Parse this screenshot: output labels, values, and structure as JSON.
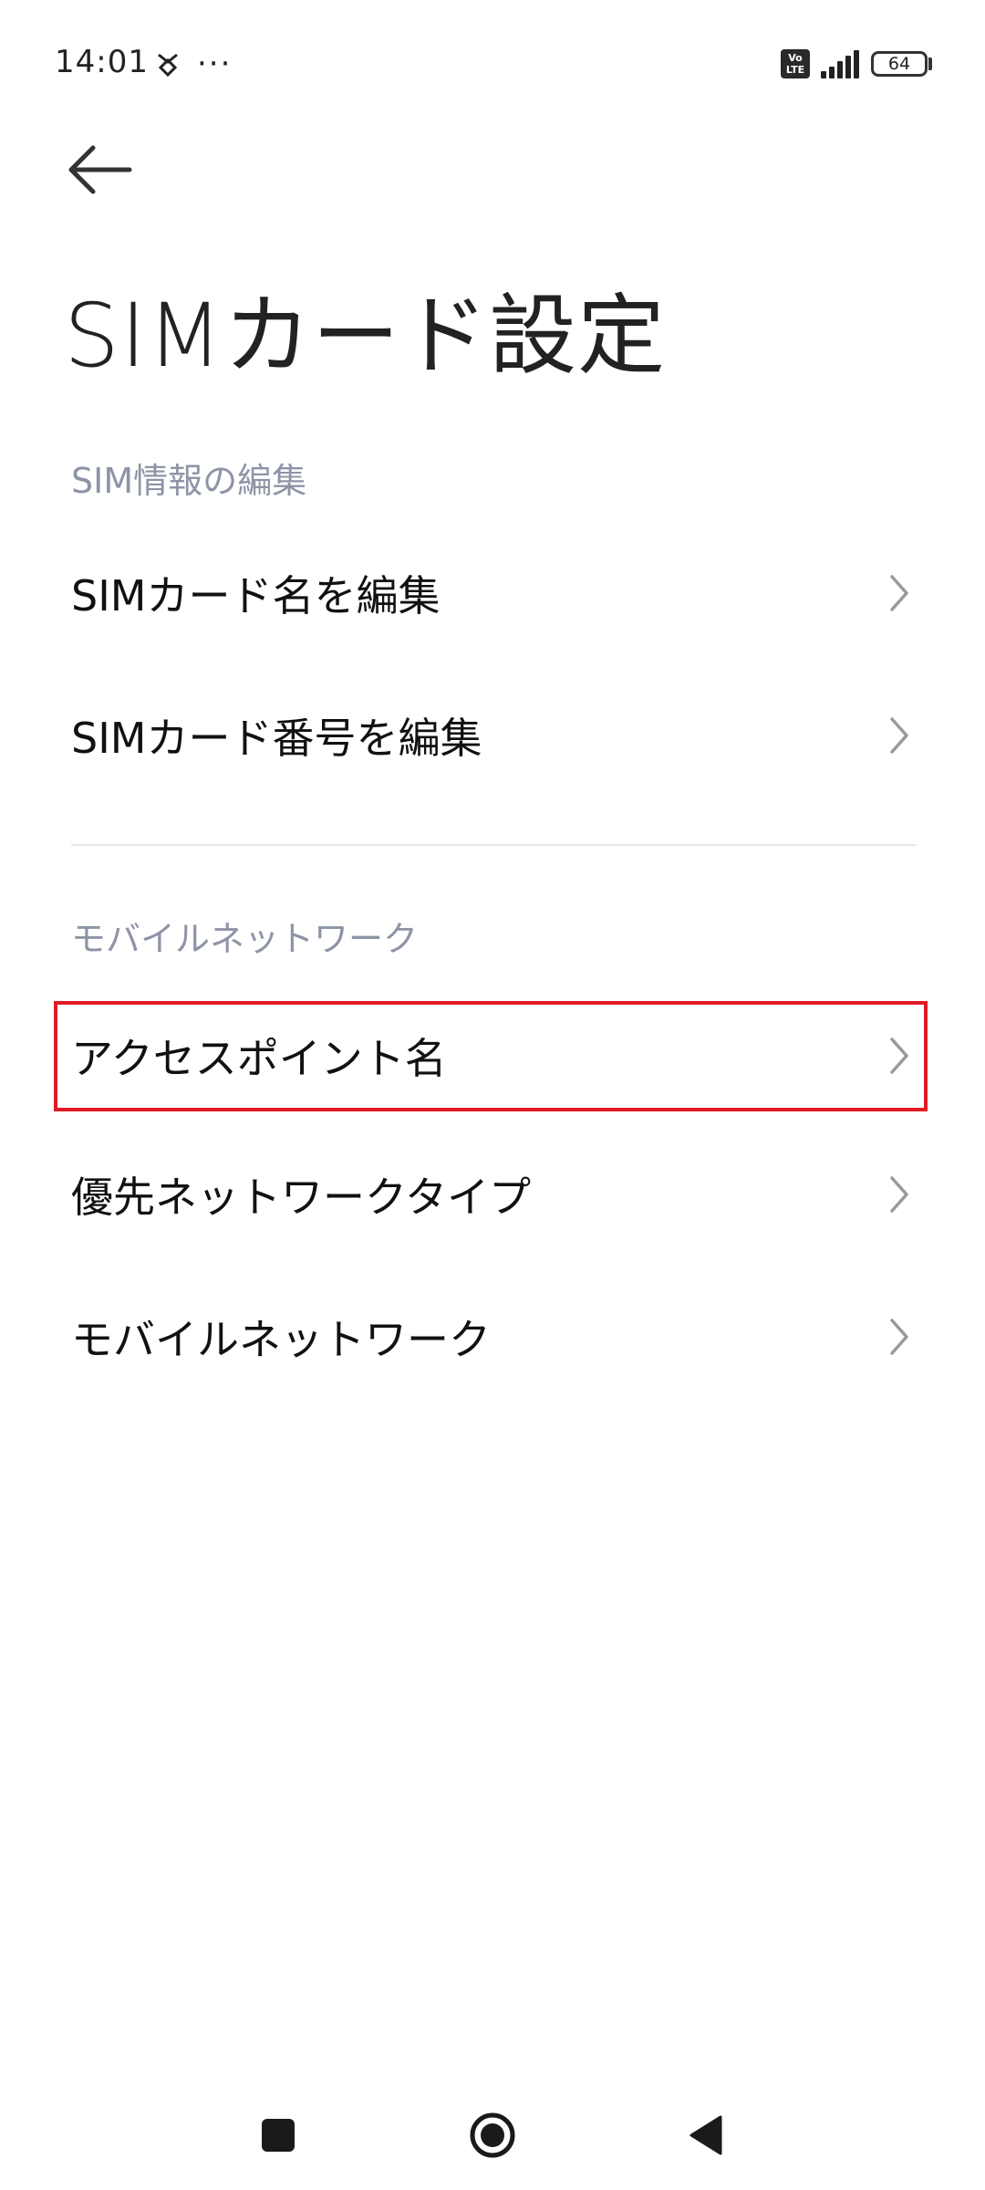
{
  "status_bar": {
    "time": "14:01",
    "more": "···",
    "volte_top": "Vo",
    "volte_bottom": "LTE",
    "battery": "64"
  },
  "header": {
    "title": "SIMカード設定"
  },
  "sections": {
    "sim_info": {
      "header": "SIM情報の編集",
      "items": [
        {
          "label": "SIMカード名を編集"
        },
        {
          "label": "SIMカード番号を編集"
        }
      ]
    },
    "mobile_network": {
      "header": "モバイルネットワーク",
      "items": [
        {
          "label": "アクセスポイント名"
        },
        {
          "label": "優先ネットワークタイプ"
        },
        {
          "label": "モバイルネットワーク"
        }
      ]
    }
  },
  "colors": {
    "section_header": "#8d94a6",
    "highlight": "#e01b24",
    "chevron": "#9a9a9a"
  },
  "icons": {
    "back": "arrow-left-icon",
    "chevron": "chevron-right-icon",
    "nav_recents": "square-icon",
    "nav_home": "circle-icon",
    "nav_back": "triangle-left-icon"
  }
}
